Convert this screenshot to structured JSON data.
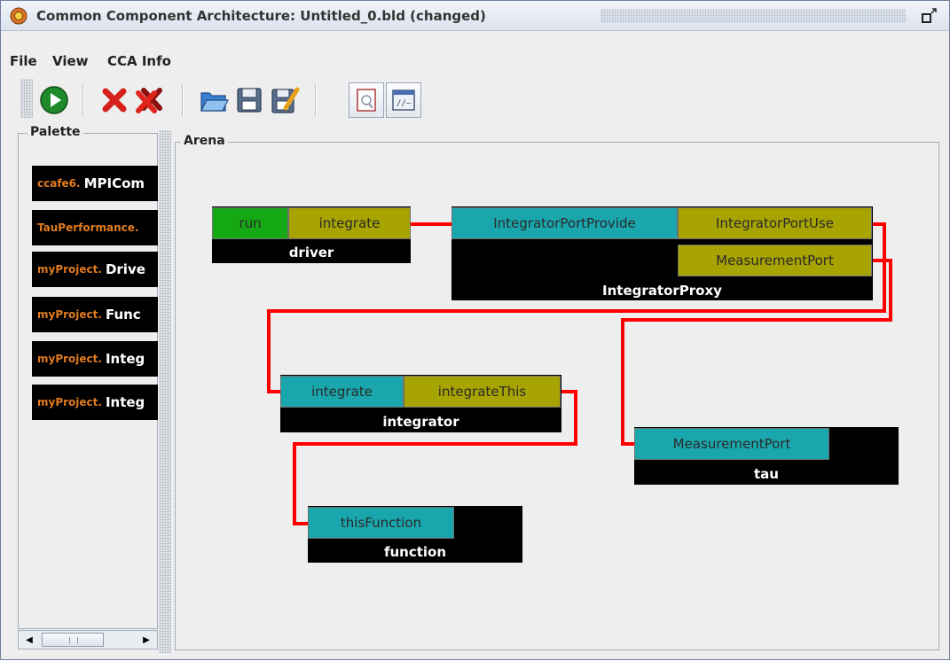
{
  "window": {
    "title": "Common Component Architecture: Untitled_0.bld (changed)"
  },
  "menu": {
    "items": [
      "File",
      "View",
      "CCA Info"
    ]
  },
  "toolbar": {
    "buttons": [
      "run-icon",
      "remove-icon",
      "remove-all-icon",
      "open-folder-icon",
      "save-icon",
      "save-as-icon",
      "document-preview-icon",
      "script-window-icon"
    ]
  },
  "palette": {
    "title": "Palette",
    "items": [
      {
        "prefix": "ccafe6.",
        "name": "MPICom"
      },
      {
        "prefix": "TauPerformance.",
        "name": ""
      },
      {
        "prefix": "myProject.",
        "name": "Drive"
      },
      {
        "prefix": "myProject.",
        "name": "Func"
      },
      {
        "prefix": "myProject.",
        "name": "Integ"
      },
      {
        "prefix": "myProject.",
        "name": "Integ"
      }
    ]
  },
  "arena": {
    "title": "Arena",
    "components": {
      "driver": {
        "label": "driver",
        "ports": {
          "go": "run",
          "uses": "integrate"
        }
      },
      "proxy": {
        "label": "IntegratorProxy",
        "ports": {
          "provides": "IntegratorPortProvide",
          "uses1": "IntegratorPortUse",
          "uses2": "MeasurementPort"
        }
      },
      "integrator": {
        "label": "integrator",
        "ports": {
          "provides": "integrate",
          "uses": "integrateThis"
        }
      },
      "tau": {
        "label": "tau",
        "ports": {
          "provides": "MeasurementPort"
        }
      },
      "function": {
        "label": "function",
        "ports": {
          "provides": "thisFunction"
        }
      }
    }
  },
  "colors": {
    "provides_port": "#1aa6ad",
    "uses_port": "#a7a300",
    "go_port": "#14a814",
    "wire": "#ff0000",
    "palette_prefix": "#e07a1f"
  }
}
